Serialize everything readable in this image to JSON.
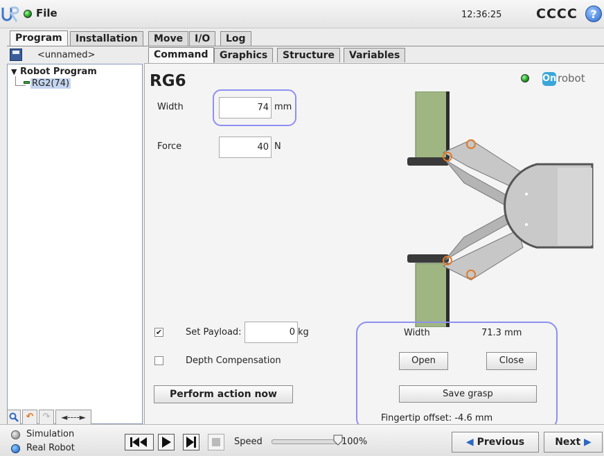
{
  "titlebar": {
    "file_menu": "File",
    "clock": "12:36:25",
    "robot_name": "CCCC",
    "help_glyph": "?"
  },
  "top_tabs": [
    "Program",
    "Installation",
    "Move",
    "I/O",
    "Log"
  ],
  "sub_tabs": [
    "Command",
    "Graphics",
    "Structure",
    "Variables"
  ],
  "file": {
    "name": "<unnamed>"
  },
  "tree": {
    "root": "Robot Program",
    "child": "RG2(74)"
  },
  "left_toolbar": {
    "arrow_label": "◄----►"
  },
  "command": {
    "title": "RG6",
    "width_label": "Width",
    "width_value": "74",
    "width_unit": "mm",
    "force_label": "Force",
    "force_value": "40",
    "force_unit": "N",
    "payload_label": "Set Payload:",
    "payload_value": "0",
    "payload_unit": "kg",
    "payload_checked": true,
    "depth_label": "Depth Compensation",
    "depth_checked": false,
    "perform_button": "Perform action now"
  },
  "gripper": {
    "brand_badge": "On",
    "brand_text": "robot",
    "width_label": "Width",
    "width_readout": "71.3 mm",
    "open_button": "Open",
    "close_button": "Close",
    "save_grasp_button": "Save grasp",
    "fingertip_offset": "Fingertip offset: -4.6 mm"
  },
  "bottom": {
    "simulation_label": "Simulation",
    "real_robot_label": "Real Robot",
    "speed_label": "Speed",
    "speed_value": "100%",
    "speed_fraction": 1.0,
    "previous_button": "Previous",
    "next_button": "Next"
  },
  "colors": {
    "status_green": "#1a9a1a",
    "highlight": "#8d8ff2",
    "tree_selection": "#c5d5ef",
    "nav_arrow": "#2d66c4"
  }
}
